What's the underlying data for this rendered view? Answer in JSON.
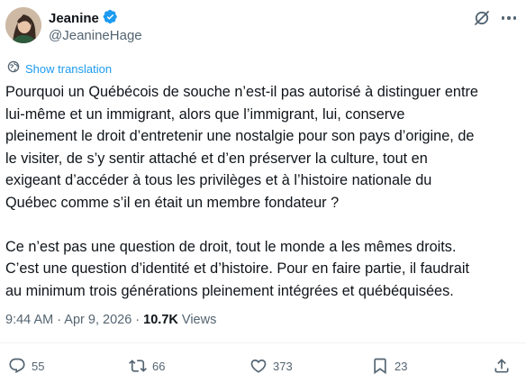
{
  "author": {
    "display_name": "Jeanine",
    "handle": "@JeanineHage",
    "verified": true,
    "verified_color": "#1d9bf0"
  },
  "translate": {
    "label": "Show translation",
    "icon": "globe-icon"
  },
  "tweet": {
    "paragraph_1": "Pourquoi un Québécois de souche n’est-il pas autorisé à distinguer entre\nlui-même et un immigrant, alors que l’immigrant, lui, conserve\npleinement le droit d’entretenir une nostalgie pour son pays d’origine, de\nle visiter, de s’y sentir attaché et d’en préserver la culture, tout en\nexigeant d’accéder à tous les privilèges et à l’histoire nationale du\nQuébec comme s’il en était un membre fondateur ?",
    "paragraph_2": "Ce n’est pas une question de droit, tout le monde a les mêmes droits.\nC’est une question d’identité et d’histoire. Pour en faire partie, il faudrait\nau minimum trois générations pleinement intégrées et québéquisées."
  },
  "meta": {
    "time": "9:44 AM",
    "separator": " · ",
    "date": "Apr 9, 2026",
    "views_count": "10.7K",
    "views_label": "Views"
  },
  "actions": {
    "replies": "55",
    "reposts": "66",
    "likes": "373",
    "bookmarks": "23"
  },
  "colors": {
    "text": "#0f1419",
    "secondary": "#536471",
    "accent": "#1d9bf0"
  }
}
